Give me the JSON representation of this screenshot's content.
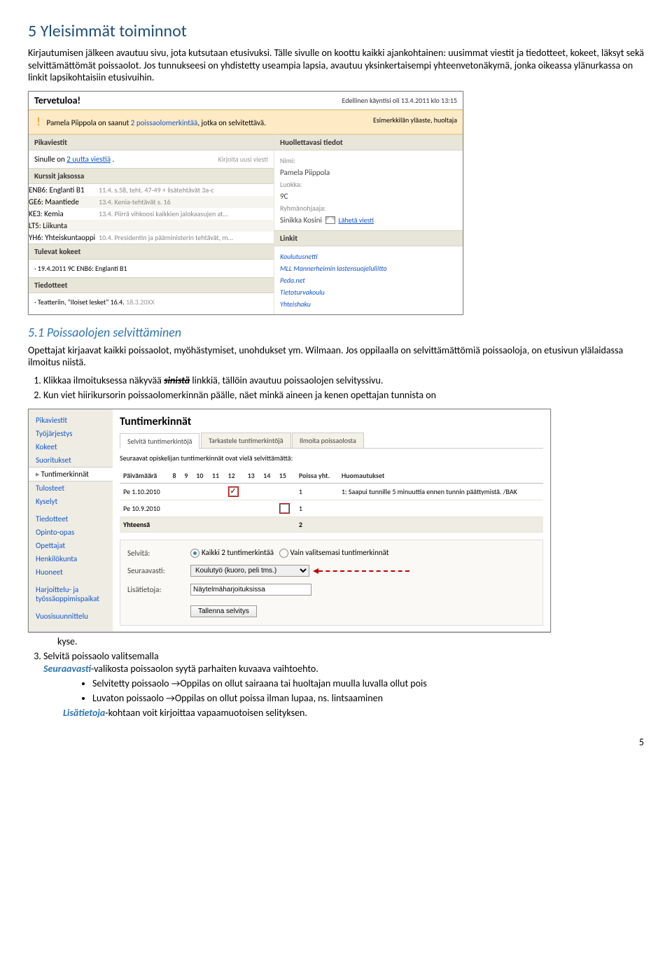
{
  "h1": "5 Yleisimmät toiminnot",
  "intro": "Kirjautumisen jälkeen avautuu sivu, jota kutsutaan etusivuksi. Tälle sivulle on koottu kaikki ajankohtainen: uusimmat viestit ja tiedotteet, kokeet, läksyt sekä selvittämättömät poissaolot. Jos tunnukseesi on yhdistetty useampia lapsia, avautuu yksinkertaisempi yhteenvetonäkymä, jonka oikeassa ylänurkassa on linkit lapsikohtaisiin etusivuihin.",
  "h2": "5.1 Poissaolojen selvittäminen",
  "para2": "Opettajat kirjaavat kaikki poissaolot, myöhästymiset, unohdukset ym. Wilmaan. Jos oppilaalla on selvittämättömiä poissaoloja, on etusivun ylälaidassa ilmoitus niistä.",
  "ol1": {
    "i1a": "Klikkaa ilmoituksessa näkyvää ",
    "i1b": "sinistä",
    "i1c": " linkkiä, tällöin avautuu poissaolojen selvityssivu.",
    "i2": "Kun viet hiirikursorin poissaolomerkinnän päälle, näet minkä aineen ja kenen opettajan tunnista on"
  },
  "after_ss2_line": "kyse.",
  "ol3a": "Selvitä poissaolo valitsemalla",
  "ol3b": "Seuraavasti",
  "ol3c": "-valikosta poissaolon syytä parhaiten kuvaava vaihtoehto.",
  "bul": {
    "b1": "Selvitetty poissaolo →Oppilas on ollut sairaana tai huoltajan muulla luvalla ollut pois",
    "b2": "Luvaton poissaolo →Oppilas on ollut poissa ilman lupaa, ns. lintsaaminen"
  },
  "last": {
    "a": "Lisätietoja",
    "b": "-kohtaan voit kirjoittaa vapaamuotoisen selityksen."
  },
  "pgnum": "5",
  "ss1": {
    "tv": "Tervetuloa!",
    "ed": "Edellinen käyntisi oli 13.4.2011 klo 13:15",
    "orange": {
      "name": "Pamela Piippola on saanut ",
      "link": "2 poissaolomerkintää",
      "rest": ", jotka on selvitettävä.",
      "role": "Esimerkkilän yläaste, huoltaja"
    },
    "pika": {
      "hd": "Pikaviestit",
      "txt1": "Sinulle on ",
      "link": "2 uutta viestiä",
      "dot": " .",
      "right": "Kirjoita uusi viesti"
    },
    "kurssit": {
      "hd": "Kurssit jaksossa",
      "rows": [
        {
          "k": "ENB6: Englanti B1",
          "d": "11.4. s.58, teht. 47-49 + lisätehtävät 3a-c"
        },
        {
          "k": "GE6: Maantiede",
          "d": "13.4. Kenia-tehtävät s. 16"
        },
        {
          "k": "KE3: Kemia",
          "d": "13.4. Piirrä vihkoosi kaikkien jalokaasujen at..."
        },
        {
          "k": "LT5: Liikunta",
          "d": ""
        },
        {
          "k": "YH6: Yhteiskuntaoppi",
          "d": "10.4. Presidentin ja pääministerin tehtävät, m..."
        }
      ]
    },
    "tulevat": {
      "hd": "Tulevat kokeet",
      "row": "· 19.4.2011 9C ENB6: Englanti B1"
    },
    "tied": {
      "hd": "Tiedotteet",
      "row": "· Teatteriin, \"Iloiset lesket\" 16.4. ",
      "gr": "18.3.20XX"
    },
    "ht": {
      "hd": "Huollettavasi tiedot",
      "nimi_l": "Nimi:",
      "nimi": "Pamela Piippola",
      "lk_l": "Luokka:",
      "lk": "9C",
      "ro_l": "Ryhmänohjaaja:",
      "ro": "Sinikka Kosini",
      "lv": "Lähetä viesti"
    },
    "linkit": {
      "hd": "Linkit",
      "items": [
        "Koulutusnetti",
        "MLL Mannerheimin lastensuojeluliitto",
        "Peda.net",
        "Tietoturvakoulu",
        "Yhteishaku"
      ]
    }
  },
  "ss2": {
    "side": [
      "Pikaviestit",
      "Työjärjestys",
      "Kokeet",
      "Suoritukset",
      "Tuntimerkinnät",
      "Tulosteet",
      "Kyselyt",
      "",
      "Tiedotteet",
      "Opinto-opas",
      "Opettajat",
      "Henkilökunta",
      "Huoneet",
      "",
      "Harjoittelu- ja työssäoppimispaikat",
      "",
      "Vuosisuunnittelu"
    ],
    "side_sel": 4,
    "title": "Tuntimerkinnät",
    "tabs": [
      "Selvitä tuntimerkintöjä",
      "Tarkastele tuntimerkintöjä",
      "Ilmoita poissaolosta"
    ],
    "lead": "Seuraavat opiskelijan tuntimerkinnät ovat vielä selvittämättä:",
    "th": [
      "Päivämäärä",
      "8",
      "9",
      "10",
      "11",
      "12",
      "13",
      "14",
      "15",
      "Poissa yht.",
      "Huomautukset"
    ],
    "rows": [
      {
        "d": "Pe 1.10.2010",
        "slot": 5,
        "ck": true,
        "yht": "1",
        "huom": "1: Saapui tunnille 5 minuuttia ennen tunnin päättymistä. /BAK"
      },
      {
        "d": "Pe 10.9.2010",
        "slot": 8,
        "ck": false,
        "yht": "1",
        "huom": ""
      }
    ],
    "sum": {
      "d": "Yhteensä",
      "yht": "2"
    },
    "form": {
      "selvita": "Selvitä:",
      "r1": "Kaikki 2 tuntimerkintää",
      "r2": "Vain valitsemasi tuntimerkinnät",
      "seur": "Seuraavasti:",
      "sel": "Koulutyö (kuoro, peli tms.)",
      "lisa": "Lisätietoja:",
      "inp": "Näytelmäharjoituksissa",
      "btn": "Tallenna selvitys"
    }
  }
}
